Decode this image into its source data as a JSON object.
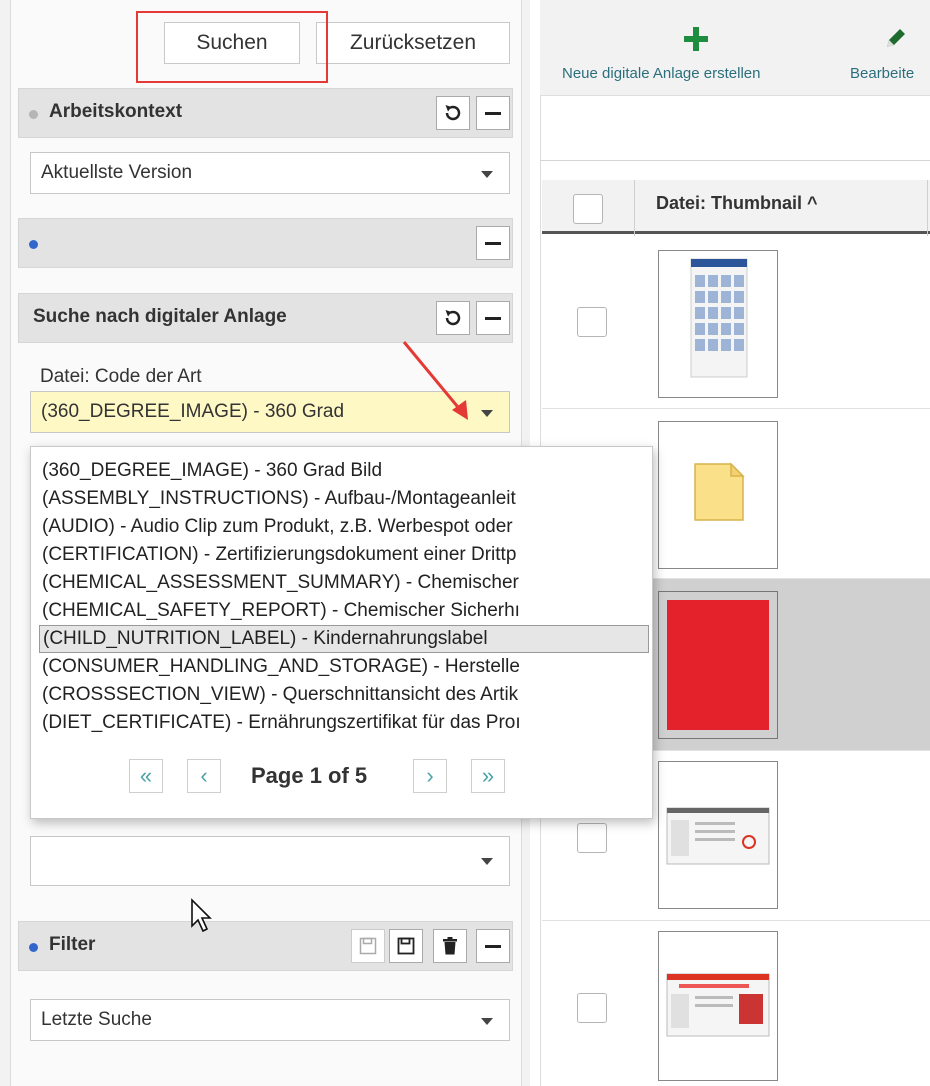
{
  "left_panel": {
    "search_button": "Suchen",
    "reset_button": "Zurücksetzen",
    "work_context": {
      "title": "Arbeitskontext",
      "selected": "Aktuellste Version"
    },
    "blank_section": {
      "title": ""
    },
    "asset_search": {
      "title": "Suche nach digitaler Anlage",
      "field_label": "Datei: Code der Art",
      "field_value": "(360_DEGREE_IMAGE) - 360 Grad",
      "dropdown_options": [
        "(360_DEGREE_IMAGE) - 360 Grad Bild",
        "(ASSEMBLY_INSTRUCTIONS) - Aufbau-/Montageanleit",
        "(AUDIO) - Audio Clip zum Produkt, z.B. Werbespot oder",
        "(CERTIFICATION) - Zertifizierungsdokument einer Drittp",
        "(CHEMICAL_ASSESSMENT_SUMMARY) - Chemischer",
        "(CHEMICAL_SAFETY_REPORT) - Chemischer Sicherhı",
        "(CHILD_NUTRITION_LABEL) - Kindernahrungslabel",
        "(CONSUMER_HANDLING_AND_STORAGE) - Herstelle",
        "(CROSSSECTION_VIEW) - Querschnittansicht des Artik",
        "(DIET_CERTIFICATE) - Ernährungszertifikat für das Proı"
      ],
      "highlighted_index": 6,
      "pager": {
        "first": "«",
        "prev": "‹",
        "label": "Page 1 of 5",
        "next": "›",
        "last": "»"
      },
      "second_field_value": ""
    },
    "filter": {
      "title": "Filter",
      "selected": "Letzte Suche"
    }
  },
  "right_panel": {
    "toolbar": {
      "new_label": "Neue digitale Anlage erstellen",
      "edit_label": "Bearbeite"
    },
    "grid": {
      "column_header": "Datei: Thumbnail ^",
      "rows": [
        {
          "thumbnail": "document-screenshot"
        },
        {
          "thumbnail": "file-icon"
        },
        {
          "thumbnail": "red-image",
          "selected": true
        },
        {
          "thumbnail": "web-screenshot"
        },
        {
          "thumbnail": "web-screenshot-red"
        }
      ]
    }
  },
  "colors": {
    "accent_red": "#e53935",
    "teal_label": "#2a6f7d",
    "green_plus": "#1e8e3e",
    "highlight_yellow": "#fdf8c4"
  }
}
